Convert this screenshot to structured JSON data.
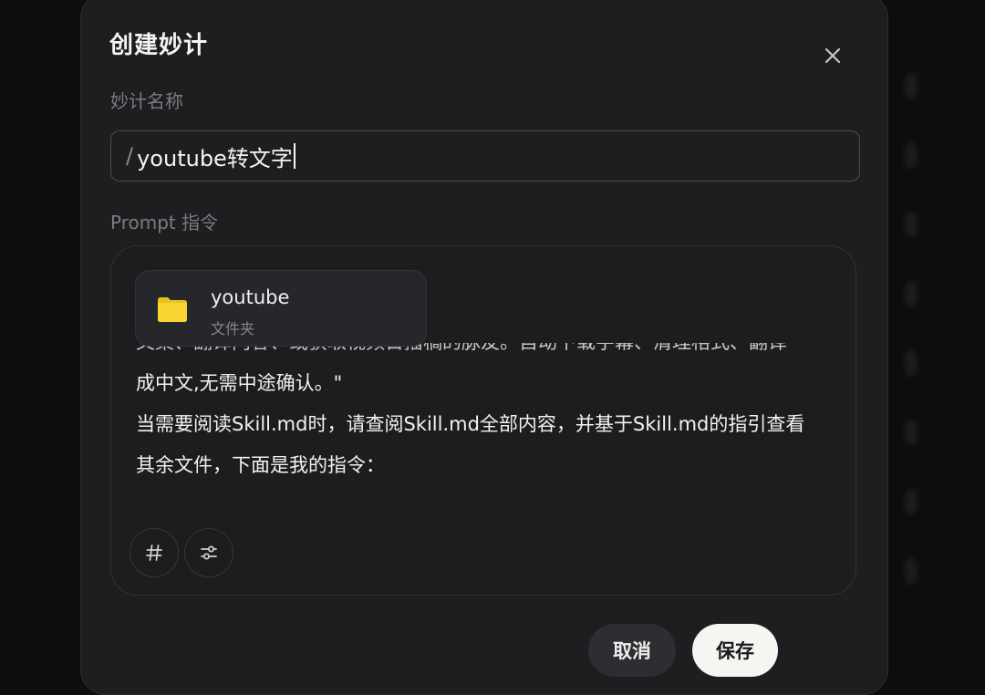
{
  "dialog": {
    "title": "创建妙计",
    "name_label": "妙计名称",
    "name_prefix": "/",
    "name_value": "youtube转文字",
    "prompt_label": "Prompt 指令",
    "attachment": {
      "name": "youtube",
      "type": "文件夹",
      "icon": "folder-icon"
    },
    "prompt_lines": [
      "文案、翻译内容、或获取视频日播稿的脉友。自动下载字幕、清理格式、翻译",
      "成中文,无需中途确认。\"",
      "当需要阅读Skill.md时，请查阅Skill.md全部内容，并基于Skill.md的指引查看",
      "其余文件，下面是我的指令："
    ],
    "tools": [
      {
        "name": "hash-icon"
      },
      {
        "name": "sliders-icon"
      }
    ],
    "cancel_label": "取消",
    "save_label": "保存"
  },
  "colors": {
    "background": "#0d0d0e",
    "modal": "#1d1e20",
    "folder": "#f7d533",
    "save_button": "#f5f5f2",
    "cancel_button": "#2d2e31"
  }
}
